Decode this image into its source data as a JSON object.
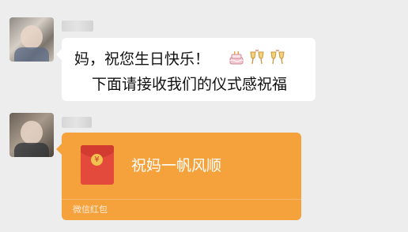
{
  "messages": [
    {
      "sender_avatar": "blurred-avatar",
      "bubble": {
        "line1": "妈，祝您生日快乐！",
        "emojis": [
          "cake-emoji",
          "cheers-emoji",
          "cheers-emoji"
        ],
        "line2": "下面请接收我们的仪式感祝福"
      }
    },
    {
      "sender_avatar": "blurred-avatar",
      "red_packet": {
        "title": "祝妈一帆风顺",
        "label": "微信红包",
        "colors": {
          "card": "#f5a23c",
          "envelope": "#e44a3c"
        }
      }
    }
  ]
}
